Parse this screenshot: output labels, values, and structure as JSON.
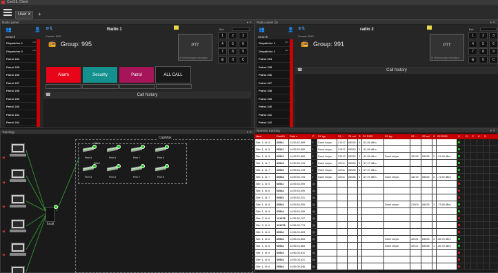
{
  "window": {
    "title": "ConSIL Client"
  },
  "tabs": [
    {
      "label": "User"
    }
  ],
  "radio1": {
    "panel_title": "Radio panel",
    "search_label": "Search",
    "dispatchers": [
      {
        "label": "Dispatcher 1",
        "sub": "102"
      },
      {
        "label": "Dispatcher 2",
        "sub": "102"
      },
      {
        "label": "Patrol 234",
        "sub": ""
      },
      {
        "label": "Patrol 235",
        "sub": ""
      },
      {
        "label": "Patrol 236",
        "sub": ""
      },
      {
        "label": "Patrol 237",
        "sub": ""
      },
      {
        "label": "Patrol 238",
        "sub": ""
      },
      {
        "label": "Patrol 239",
        "sub": ""
      },
      {
        "label": "Patrol 240",
        "sub": ""
      },
      {
        "label": "Patrol 241",
        "sub": ""
      },
      {
        "label": "Patrol 242",
        "sub": ""
      }
    ],
    "name": "Radio 1",
    "console_label": "Console: DMR",
    "group": "Group: 995",
    "ptt": "PTT",
    "ptt_sub": "Verbindungen anzeigen",
    "kp_label": "Ext:",
    "keypad": [
      "1",
      "2",
      "3",
      "4",
      "5",
      "6",
      "7",
      "8",
      "9",
      "⚙",
      "0",
      "C"
    ],
    "buttons": [
      {
        "label": "Alarm",
        "color": "#e8051a"
      },
      {
        "label": "Security",
        "color": "#14918f"
      },
      {
        "label": "Patrol",
        "color": "#a6145a"
      },
      {
        "label": "ALL CALL",
        "color": "#181818"
      }
    ],
    "history": "Call history"
  },
  "radio2": {
    "panel_title": "Radio panel (2)",
    "search_label": "Search",
    "dispatchers": [
      {
        "label": "Dispatcher 1",
        "sub": "102"
      },
      {
        "label": "Dispatcher 2",
        "sub": "102"
      },
      {
        "label": "Patrol 234",
        "sub": ""
      },
      {
        "label": "Patrol 235",
        "sub": ""
      },
      {
        "label": "Patrol 236",
        "sub": ""
      },
      {
        "label": "Patrol 237",
        "sub": ""
      },
      {
        "label": "Patrol 238",
        "sub": ""
      },
      {
        "label": "Patrol 239",
        "sub": ""
      },
      {
        "label": "Patrol 240",
        "sub": ""
      },
      {
        "label": "Patrol 241",
        "sub": ""
      },
      {
        "label": "Patrol 242",
        "sub": ""
      }
    ],
    "name": "radio 2",
    "console_label": "Console: DMR",
    "group": "Group: 991",
    "ptt": "PTT",
    "ptt_sub": "Verbindungen anzeigen",
    "kp_label": "Ext:",
    "keypad": [
      "1",
      "2",
      "3",
      "4",
      "5",
      "6",
      "7",
      "8",
      "9",
      "⚙",
      "0",
      "C"
    ],
    "history": "Call history"
  },
  "topology": {
    "title": "Topology",
    "capmax": "CapMax",
    "local": "local",
    "site1": "Site1",
    "site2": "Site2",
    "peers_top": [
      "Peer 5",
      "Peer 6",
      "Peer 7",
      "Peer 8"
    ],
    "peers_bottom": [
      "Peer 5",
      "Peer 6",
      "Peer 7",
      "Peer 8"
    ]
  },
  "numeric": {
    "title": "Numeric tracking",
    "columns": [
      "ident",
      "Rad/ID",
      "Date z",
      "P",
      "S1 typ",
      "S1 ...",
      "S1 cel",
      "S",
      "S1 RSSI",
      "S2 typ",
      "S2 ...",
      "S2 cel",
      "S",
      "S2 RSSI",
      "S",
      "G",
      "C",
      "K",
      "S",
      ""
    ],
    "rows": [
      [
        "Site: 1, Id: 5",
        "65541",
        "14:55:52,889",
        "i",
        "Dane indyw.",
        "21512",
        "65535",
        "3",
        "-61.86 dBm",
        "",
        "",
        "",
        "",
        "",
        "g"
      ],
      [
        "Site: 1, Id: 5",
        "65541",
        "14:55:52,889",
        "i",
        "Dane indyw.",
        "21512",
        "65535",
        "3",
        "-61.86 dBm",
        "",
        "",
        "",
        "",
        "",
        "g"
      ],
      [
        "Site: 1, Id: 5",
        "65541",
        "14:55:52,889",
        "i",
        "Dane indyw.",
        "21512",
        "65535",
        "3",
        "-61.86 dBm",
        "Dane indyw.",
        "42129",
        "65535",
        "3",
        "-91.48 dBm",
        "g"
      ],
      [
        "Site: 1, Id: 7",
        "65543",
        "14:55:53,193",
        "i",
        "Dane indyw.",
        "42111",
        "65535",
        "3",
        "-57.97 dBm",
        "",
        "",
        "",
        "",
        "",
        "g"
      ],
      [
        "Site: 1, Id: 7",
        "65543",
        "14:55:53,193",
        "i",
        "Dane indyw.",
        "42111",
        "65535",
        "3",
        "-57.97 dBm",
        "",
        "",
        "",
        "",
        "",
        "g"
      ],
      [
        "Site: 1, Id: 7",
        "65543",
        "14:55:53,193",
        "i",
        "Dane indyw.",
        "42111",
        "65535",
        "3",
        "-57.97 dBm",
        "Dane indyw.",
        "44219",
        "65535",
        "3",
        "-71.92 dBm",
        "g"
      ],
      [
        "Site: 1, Id: 5",
        "65541",
        "14:55:53,699",
        "m",
        "",
        "",
        "",
        "",
        "",
        "",
        "",
        "",
        "",
        "",
        "r"
      ],
      [
        "Site: 1, Id: 6",
        "65544",
        "14:55:53,699",
        "m",
        "",
        "",
        "",
        "",
        "",
        "",
        "",
        "",
        "",
        "",
        "r"
      ],
      [
        "Site: 1, Id: 7",
        "65543",
        "14:55:54,201",
        "m",
        "",
        "",
        "",
        "",
        "",
        "",
        "",
        "",
        "",
        "",
        "r"
      ],
      [
        "Site: 1, Id: 6",
        "65544",
        "14:55:54,955",
        "m",
        "",
        "",
        "",
        "",
        "",
        "Dane indyw.",
        "21509",
        "65535",
        "3",
        "-73.68 dBm",
        "g"
      ],
      [
        "Site: 1, Id: 6",
        "65544",
        "14:55:54,955",
        "m",
        "",
        "",
        "",
        "",
        "",
        "",
        "",
        "",
        "",
        "",
        "g"
      ],
      [
        "Site: 2, Id: 6",
        "131078",
        "14:55:59,767",
        "m",
        "",
        "",
        "",
        "",
        "",
        "",
        "",
        "",
        "",
        "",
        "r"
      ],
      [
        "Site: 2, Id: 6",
        "131078",
        "14:56:00,774",
        "m",
        "",
        "",
        "",
        "",
        "",
        "",
        "",
        "",
        "",
        "",
        "r"
      ],
      [
        "Site: 1, Id: 6",
        "65544",
        "14:56:04,863",
        "m",
        "",
        "",
        "",
        "",
        "",
        "",
        "",
        "",
        "",
        "",
        "r"
      ],
      [
        "Site: 1, Id: 6",
        "65544",
        "14:56:04,863",
        "m",
        "",
        "",
        "",
        "",
        "",
        "Dane indyw.",
        "42221",
        "65535",
        "3",
        "-66.75 dBm",
        "g"
      ],
      [
        "Site: 1, Id: 6",
        "65544",
        "14:56:04,863",
        "m",
        "",
        "",
        "",
        "",
        "",
        "Dane indyw.",
        "42221",
        "65535",
        "1",
        "-66.75 dBm",
        "g"
      ],
      [
        "Site: 1, Id: 6",
        "65544",
        "14:56:05,831",
        "m",
        "",
        "",
        "",
        "",
        "",
        "",
        "",
        "",
        "",
        "",
        "r"
      ],
      [
        "Site: 1, Id: 6",
        "65544",
        "14:56:05,831",
        "m",
        "",
        "",
        "",
        "",
        "",
        "",
        "",
        "",
        "",
        "",
        "r"
      ],
      [
        "Site: 1, Id: 6",
        "65544",
        "14:56:06,846",
        "m",
        "",
        "",
        "",
        "",
        "",
        "",
        "",
        "",
        "",
        "",
        "r"
      ]
    ]
  }
}
